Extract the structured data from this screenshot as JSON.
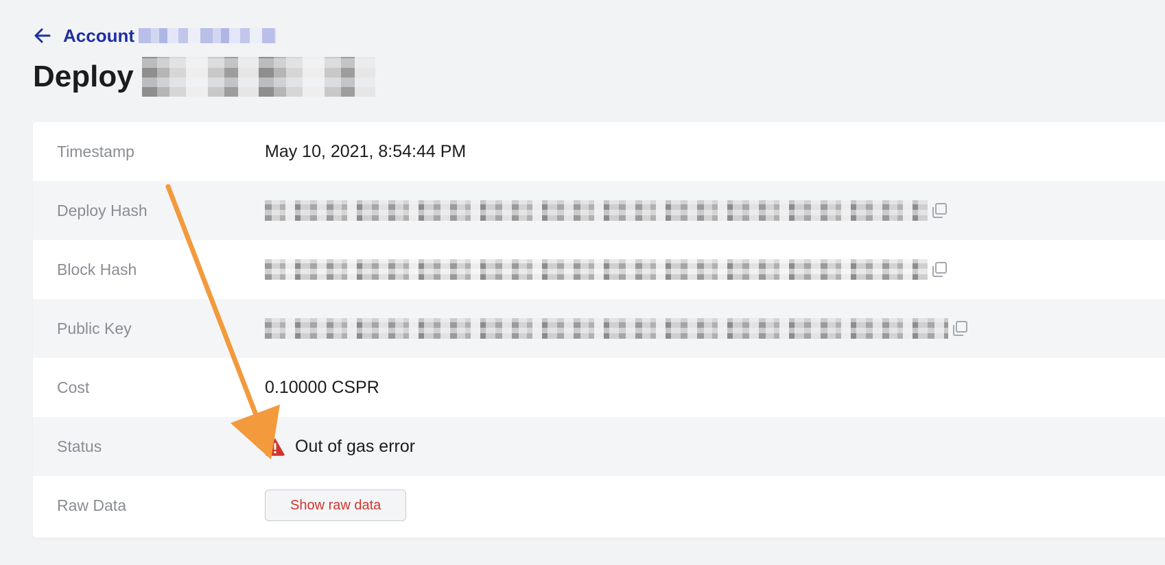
{
  "breadcrumb": {
    "label": "Account"
  },
  "page_title": "Deploy",
  "rows": [
    {
      "label": "Timestamp",
      "value": "May 10, 2021, 8:54:44 PM"
    },
    {
      "label": "Deploy Hash"
    },
    {
      "label": "Block Hash"
    },
    {
      "label": "Public Key"
    },
    {
      "label": "Cost",
      "value": "0.10000 CSPR"
    },
    {
      "label": "Status",
      "value": "Out of gas error"
    },
    {
      "label": "Raw Data",
      "button": "Show raw data"
    }
  ],
  "colors": {
    "background": "#f2f3f5",
    "link": "#1f2fa0",
    "error": "#d0352b",
    "annotation_arrow": "#f29a3c"
  },
  "icons": [
    "back-arrow-icon",
    "copy-icon",
    "warning-icon"
  ]
}
